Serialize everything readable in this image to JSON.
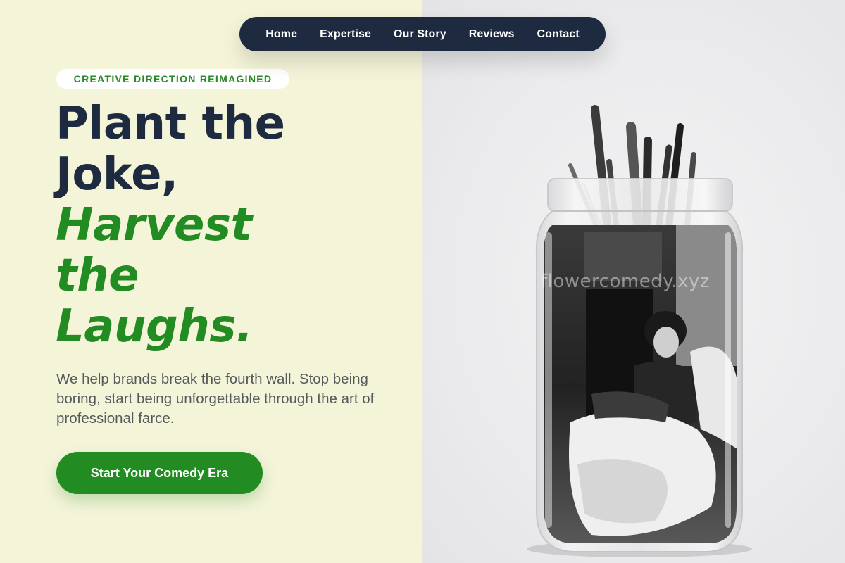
{
  "nav": {
    "items": [
      {
        "label": "Home"
      },
      {
        "label": "Expertise"
      },
      {
        "label": "Our Story"
      },
      {
        "label": "Reviews"
      },
      {
        "label": "Contact"
      }
    ]
  },
  "hero": {
    "badge": "CREATIVE DIRECTION REIMAGINED",
    "headline": {
      "line1": "Plant the",
      "line2": "Joke,",
      "line3": "Harvest",
      "line4": "the",
      "line5": "Laughs."
    },
    "subtext": "We help brands break the fourth wall. Stop being boring, start being unforgettable through the art of professional farce.",
    "cta_label": "Start Your Comedy Era"
  },
  "image": {
    "watermark": "flowercomedy.xyz"
  },
  "colors": {
    "navy": "#1e2a3f",
    "green": "#228b22",
    "cream": "#f4f4d9"
  }
}
